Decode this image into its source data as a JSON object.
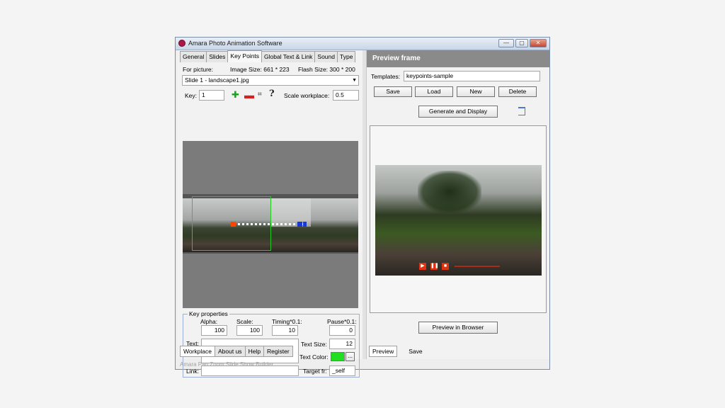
{
  "window": {
    "title": "Amara Photo Animation Software",
    "buttons": {
      "minimize": "—",
      "maximize": "▢",
      "close": "✕"
    },
    "status_text": "Amara Pan Zoom Slide Show Builder"
  },
  "left": {
    "tabs": [
      "General",
      "Slides",
      "Key Points",
      "Global Text & Link",
      "Sound",
      "Type"
    ],
    "info": {
      "for_picture_label": "For picture:",
      "image_size_text": "Image Size: 661 * 223",
      "flash_size_text": "Flash Size: 300 * 200"
    },
    "slide_select_value": "Slide 1 - landscape1.jpg",
    "key_label": "Key:",
    "key_value": "1",
    "toolbar_icons": [
      "plus-icon",
      "minus-icon",
      "crop-icon",
      "help-icon"
    ],
    "help_glyph": "?",
    "scale_workplace_label": "Scale workplace:",
    "scale_workplace_value": "0.5",
    "key_properties": {
      "legend": "Key properties",
      "alpha_label": "Alpha:",
      "alpha_value": "100",
      "scale_label": "Scale:",
      "scale_value": "100",
      "timing_label": "Timing*0.1:",
      "timing_value": "10",
      "pause_label": "Pause*0.1:",
      "pause_value": "0",
      "text_label": "Text:",
      "text_value": "",
      "text_size_label": "Text Size:",
      "text_size_value": "12",
      "text_color_label": "Text Color:",
      "text_color_hex": "#22dd22",
      "more_button": "...",
      "link_label": "Link:",
      "link_value": "",
      "target_label": "Target fr:",
      "target_value": "_self"
    },
    "bottom_tabs": [
      "Workplace",
      "About us",
      "Help",
      "Register"
    ]
  },
  "right": {
    "header": "Preview frame",
    "templates_label": "Templates:",
    "templates_value": "keypoints-sample",
    "buttons": {
      "save": "Save",
      "load": "Load",
      "new": "New",
      "delete": "Delete"
    },
    "generate_button": "Generate and Display",
    "preview_in_browser_button": "Preview in Browser",
    "bottom_tabs": [
      "Preview",
      "Save"
    ]
  },
  "colors": {
    "keypoint_start": "#ff4400",
    "keypoint_end": "#1a3ad6",
    "selection_frame": "#22cc22",
    "player_button": "#dd3311"
  }
}
